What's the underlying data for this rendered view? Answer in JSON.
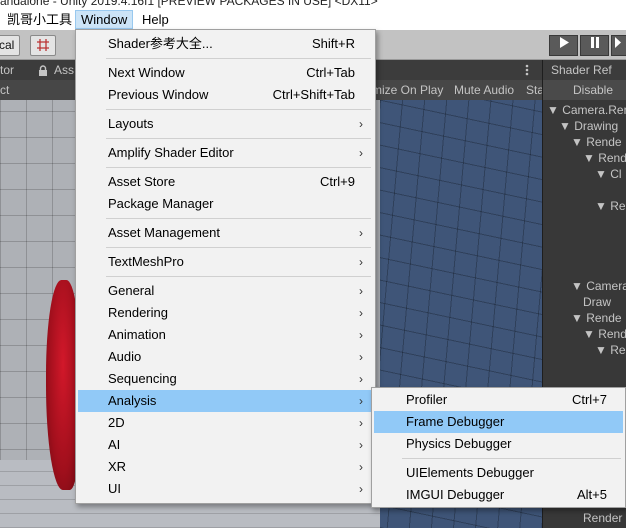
{
  "title": "andalone - Unity 2019.4.16f1 [PREVIEW PACKAGES IN USE] <DX11>",
  "menubar": [
    {
      "label": "凯哥小工具"
    },
    {
      "label": "Window"
    },
    {
      "label": "Help"
    }
  ],
  "toolbar": {
    "local_label": "cal",
    "grid_icon": "grid-snap-icon",
    "play_icon": "play-icon",
    "pause_icon": "pause-icon",
    "step_icon": "step-icon"
  },
  "inspector": {
    "tab_label": "tor",
    "lock_icon": "lock-icon",
    "asset_label": "Ass",
    "sub_label": "ct"
  },
  "game_view": {
    "maximize_label": "mize On Play",
    "mute_label": "Mute Audio",
    "stats_label": "Sta",
    "more_icon": "kebab-menu-icon"
  },
  "shader_ref": {
    "title": "Shader Ref",
    "disable_label": "Disable",
    "tree": [
      {
        "label": "▼ Camera.Ren",
        "indent": 0
      },
      {
        "label": "▼ Drawing",
        "indent": 1
      },
      {
        "label": "▼ Rende",
        "indent": 2
      },
      {
        "label": "▼ Rend",
        "indent": 3
      },
      {
        "label": "▼ Cl",
        "indent": 4
      },
      {
        "label": "▼ Re",
        "indent": 4
      },
      {
        "label": "▼ Camera",
        "indent": 2
      },
      {
        "label": "Draw",
        "indent": 3
      },
      {
        "label": "▼ Rende",
        "indent": 2
      },
      {
        "label": "▼ Rend",
        "indent": 3
      },
      {
        "label": "▼ Re",
        "indent": 4
      },
      {
        "label": "Render",
        "indent": 3
      }
    ]
  },
  "window_menu": {
    "arrow": "›",
    "items": [
      {
        "label": "Shader参考大全...",
        "shortcut": "Shift+R"
      },
      {
        "sep": true
      },
      {
        "label": "Next Window",
        "shortcut": "Ctrl+Tab"
      },
      {
        "label": "Previous Window",
        "shortcut": "Ctrl+Shift+Tab"
      },
      {
        "sep": true
      },
      {
        "label": "Layouts",
        "submenu": true
      },
      {
        "sep": true
      },
      {
        "label": "Amplify Shader Editor",
        "submenu": true
      },
      {
        "sep": true
      },
      {
        "label": "Asset Store",
        "shortcut": "Ctrl+9"
      },
      {
        "label": "Package Manager"
      },
      {
        "sep": true
      },
      {
        "label": "Asset Management",
        "submenu": true
      },
      {
        "sep": true
      },
      {
        "label": "TextMeshPro",
        "submenu": true
      },
      {
        "sep": true
      },
      {
        "label": "General",
        "submenu": true
      },
      {
        "label": "Rendering",
        "submenu": true
      },
      {
        "label": "Animation",
        "submenu": true
      },
      {
        "label": "Audio",
        "submenu": true
      },
      {
        "label": "Sequencing",
        "submenu": true
      },
      {
        "label": "Analysis",
        "submenu": true,
        "highlighted": true
      },
      {
        "label": "2D",
        "submenu": true
      },
      {
        "label": "AI",
        "submenu": true
      },
      {
        "label": "XR",
        "submenu": true
      },
      {
        "label": "UI",
        "submenu": true
      }
    ]
  },
  "analysis_menu": {
    "items": [
      {
        "label": "Profiler",
        "shortcut": "Ctrl+7"
      },
      {
        "label": "Frame Debugger",
        "highlighted": true
      },
      {
        "label": "Physics Debugger"
      },
      {
        "sep": true
      },
      {
        "label": "UIElements Debugger"
      },
      {
        "label": "IMGUI Debugger",
        "shortcut": "Alt+5"
      }
    ]
  }
}
